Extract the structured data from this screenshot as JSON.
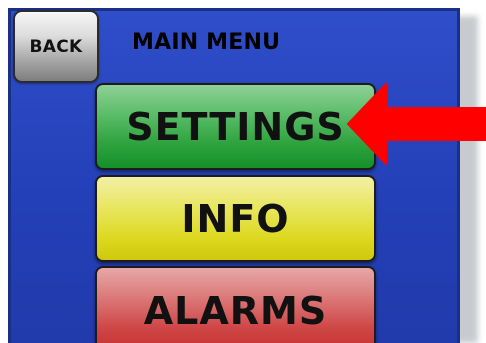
{
  "header": {
    "back_label": "BACK",
    "title": "MAIN MENU"
  },
  "menu": {
    "items": [
      {
        "label": "SETTINGS",
        "color": "#2fa33f"
      },
      {
        "label": "INFO",
        "color": "#dcd81e"
      },
      {
        "label": "ALARMS",
        "color": "#cf4646"
      }
    ]
  },
  "indicator": {
    "icon": "red-arrow-left-icon",
    "color": "#ff0000",
    "target": "SETTINGS"
  },
  "colors": {
    "panel": "#2440b8",
    "back_button": "#a7a7a7"
  }
}
